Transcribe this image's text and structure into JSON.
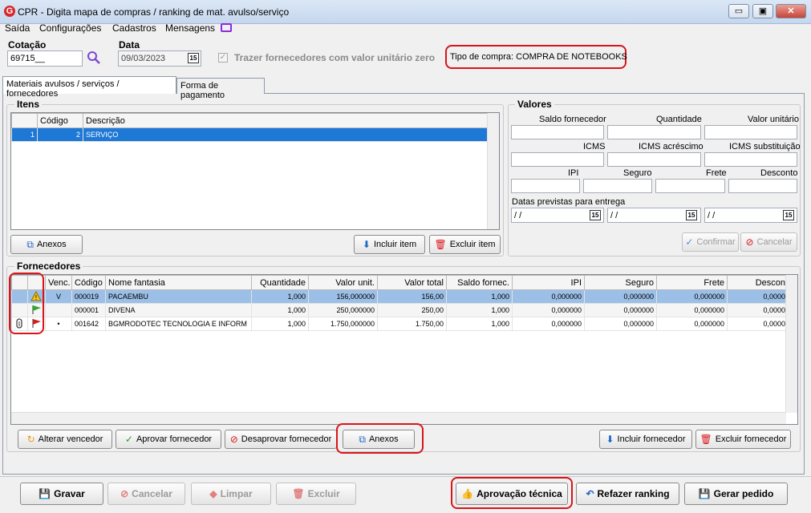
{
  "window": {
    "title": "CPR - Digita mapa de compras / ranking de mat. avulso/serviço",
    "logo_letter": "G",
    "btn_min": "▭",
    "btn_max": "▣",
    "btn_close": "✕"
  },
  "menu": [
    "Saída",
    "Configurações",
    "Cadastros",
    "Mensagens"
  ],
  "header": {
    "cotacao_label": "Cotação",
    "cotacao_value": "69715__",
    "data_label": "Data",
    "data_value": "09/03/2023",
    "trazer_label": "Trazer fornecedores com valor unitário zero",
    "tipo_compra": "Tipo de compra: COMPRA DE NOTEBOOKS"
  },
  "tabs": [
    "Materiais avulsos / serviços / fornecedores",
    "Forma de pagamento"
  ],
  "itens": {
    "title": "Itens",
    "columns": [
      "",
      "Código",
      "Descrição"
    ],
    "rows": [
      {
        "num": "1",
        "codigo": "2",
        "descricao": "SERVIÇO"
      }
    ],
    "anexos": "Anexos",
    "incluir": "Incluir item",
    "excluir": "Excluir item"
  },
  "valores": {
    "title": "Valores",
    "saldo_fornecedor": "Saldo fornecedor",
    "quantidade": "Quantidade",
    "valor_unitario": "Valor unitário",
    "icms": "ICMS",
    "icms_acrescimo": "ICMS acréscimo",
    "icms_substituicao": "ICMS substituição",
    "ipi": "IPI",
    "seguro": "Seguro",
    "frete": "Frete",
    "desconto": "Desconto",
    "datas_previstas": "Datas previstas para entrega",
    "date_placeholder": " / /",
    "confirmar": "Confirmar",
    "cancelar": "Cancelar"
  },
  "fornecedores": {
    "title": "Fornecedores",
    "columns": [
      "",
      "",
      "Venc.",
      "Código",
      "Nome fantasia",
      "Quantidade",
      "Valor unit.",
      "Valor total",
      "Saldo fornec.",
      "IPI",
      "Seguro",
      "Frete",
      "Descon"
    ],
    "rows": [
      {
        "status": "warning",
        "clip": false,
        "venc": "V",
        "codigo": "000019",
        "nome": "PACAEMBU",
        "quantidade": "1,000",
        "valor_unit": "156,000000",
        "valor_total": "156,00",
        "saldo": "1,000",
        "ipi": "0,000000",
        "seguro": "0,000000",
        "frete": "0,000000",
        "desconto": "0,0000"
      },
      {
        "status": "green",
        "clip": false,
        "venc": "",
        "codigo": "000001",
        "nome": "DIVENA",
        "quantidade": "1,000",
        "valor_unit": "250,000000",
        "valor_total": "250,00",
        "saldo": "1,000",
        "ipi": "0,000000",
        "seguro": "0,000000",
        "frete": "0,000000",
        "desconto": "0,0000"
      },
      {
        "status": "red",
        "clip": true,
        "venc": "•",
        "codigo": "001642",
        "nome": "BGMRODOTEC TECNOLOGIA E INFORM",
        "quantidade": "1,000",
        "valor_unit": "1.750,000000",
        "valor_total": "1.750,00",
        "saldo": "1,000",
        "ipi": "0,000000",
        "seguro": "0,000000",
        "frete": "0,000000",
        "desconto": "0,0000"
      }
    ],
    "alterar": "Alterar vencedor",
    "aprovar": "Aprovar fornecedor",
    "desaprovar": "Desaprovar fornecedor",
    "anexos": "Anexos",
    "incluir": "Incluir fornecedor",
    "excluir": "Excluir fornecedor"
  },
  "footer": {
    "gravar": "Gravar",
    "cancelar": "Cancelar",
    "limpar": "Limpar",
    "excluir": "Excluir",
    "aprovacao": "Aprovação técnica",
    "refazer": "Refazer ranking",
    "gerar": "Gerar pedido"
  }
}
